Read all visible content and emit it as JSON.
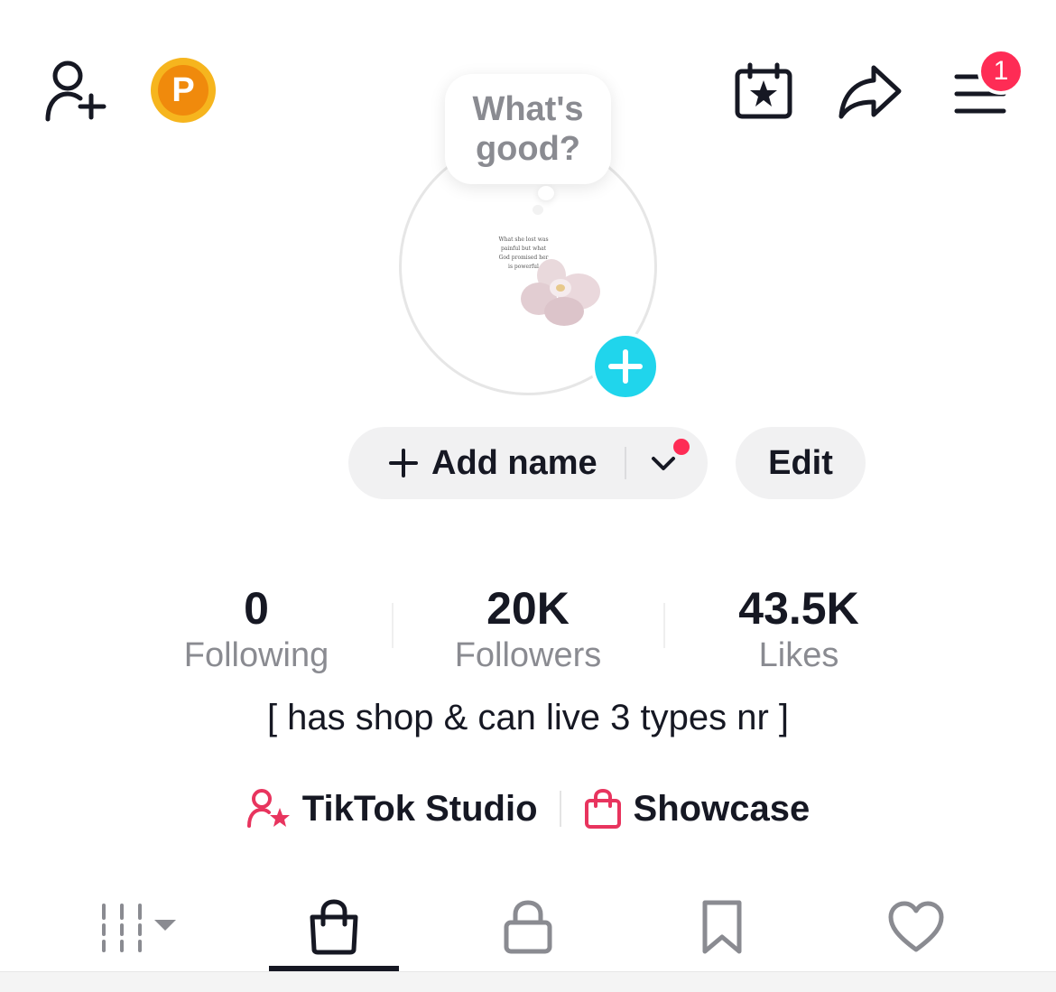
{
  "header": {
    "add_friends_icon": "person-plus-icon",
    "coin_letter": "P",
    "calendar_icon": "calendar-star-icon",
    "share_icon": "share-arrow-icon",
    "menu_icon": "hamburger-menu-icon",
    "menu_badge": "1"
  },
  "profile": {
    "bubble_text_line1": "What's",
    "bubble_text_line2": "good?",
    "avatar_text_lines": [
      "What she lost was",
      "painful but what",
      "God promised her",
      "is powerful"
    ],
    "add_name_label": "Add name",
    "edit_label": "Edit"
  },
  "stats": [
    {
      "value": "0",
      "label": "Following"
    },
    {
      "value": "20K",
      "label": "Followers"
    },
    {
      "value": "43.5K",
      "label": "Likes"
    }
  ],
  "bio": "[ has shop & can live 3 types nr ]",
  "links": {
    "studio_label": "TikTok Studio",
    "showcase_label": "Showcase"
  },
  "tabs": [
    {
      "icon": "grid-icon",
      "active": false
    },
    {
      "icon": "shopping-bag-icon",
      "active": true
    },
    {
      "icon": "lock-icon",
      "active": false
    },
    {
      "icon": "bookmark-icon",
      "active": false
    },
    {
      "icon": "heart-icon",
      "active": false
    }
  ],
  "colors": {
    "accent_red": "#fe2c55",
    "add_blue": "#20d5ec",
    "coin_gold": "#f6b51e",
    "text_primary": "#161823",
    "text_secondary": "#8a8b91"
  }
}
